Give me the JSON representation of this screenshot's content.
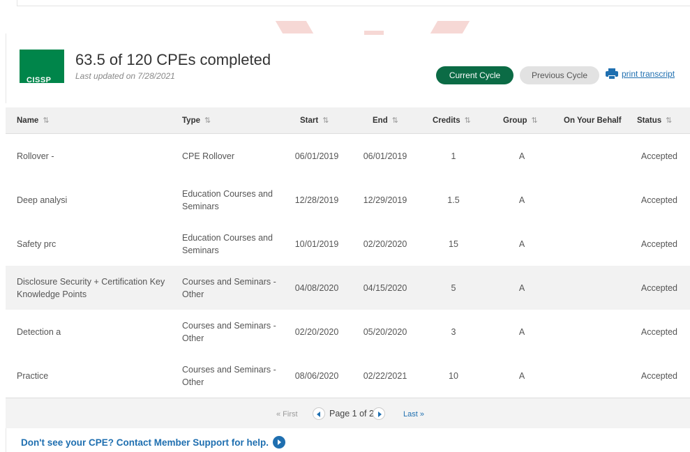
{
  "header": {
    "logo_text": "CISSP",
    "headline": "63.5 of 120 CPEs completed",
    "updated": "Last updated on 7/28/2021",
    "current_cycle": "Current Cycle",
    "previous_cycle": "Previous Cycle",
    "print_transcript": "print transcript"
  },
  "table": {
    "sort_glyph": "⇅",
    "columns": {
      "name": "Name",
      "type": "Type",
      "start": "Start",
      "end": "End",
      "credits": "Credits",
      "group": "Group",
      "behalf": "On Your Behalf",
      "status": "Status"
    },
    "rows": [
      {
        "name": "Rollover -",
        "type": "CPE Rollover",
        "start": "06/01/2019",
        "end": "06/01/2019",
        "credits": "1",
        "group": "A",
        "behalf": "",
        "status": "Accepted"
      },
      {
        "name": "Deep analysi",
        "type": "Education Courses and Seminars",
        "start": "12/28/2019",
        "end": "12/29/2019",
        "credits": "1.5",
        "group": "A",
        "behalf": "",
        "status": "Accepted"
      },
      {
        "name": "Safety prc",
        "type": "Education Courses and Seminars",
        "start": "10/01/2019",
        "end": "02/20/2020",
        "credits": "15",
        "group": "A",
        "behalf": "",
        "status": "Accepted"
      },
      {
        "name": "Disclosure Security + Certification Key Knowledge Points",
        "type": "Courses and Seminars - Other",
        "start": "04/08/2020",
        "end": "04/15/2020",
        "credits": "5",
        "group": "A",
        "behalf": "",
        "status": "Accepted"
      },
      {
        "name": "Detection a",
        "type": "Courses and Seminars - Other",
        "start": "02/20/2020",
        "end": "05/20/2020",
        "credits": "3",
        "group": "A",
        "behalf": "",
        "status": "Accepted"
      },
      {
        "name": "Practice",
        "type": "Courses and Seminars - Other",
        "start": "08/06/2020",
        "end": "02/22/2021",
        "credits": "10",
        "group": "A",
        "behalf": "",
        "status": "Accepted"
      }
    ]
  },
  "pager": {
    "first": "« First",
    "label": "Page 1 of 2",
    "last": "Last »"
  },
  "footer": {
    "help": "Don't see your CPE? Contact Member Support for help."
  },
  "colors": {
    "brand_green": "#0b6b45",
    "logo_green": "#00854a",
    "link_blue": "#1f6fb0"
  }
}
